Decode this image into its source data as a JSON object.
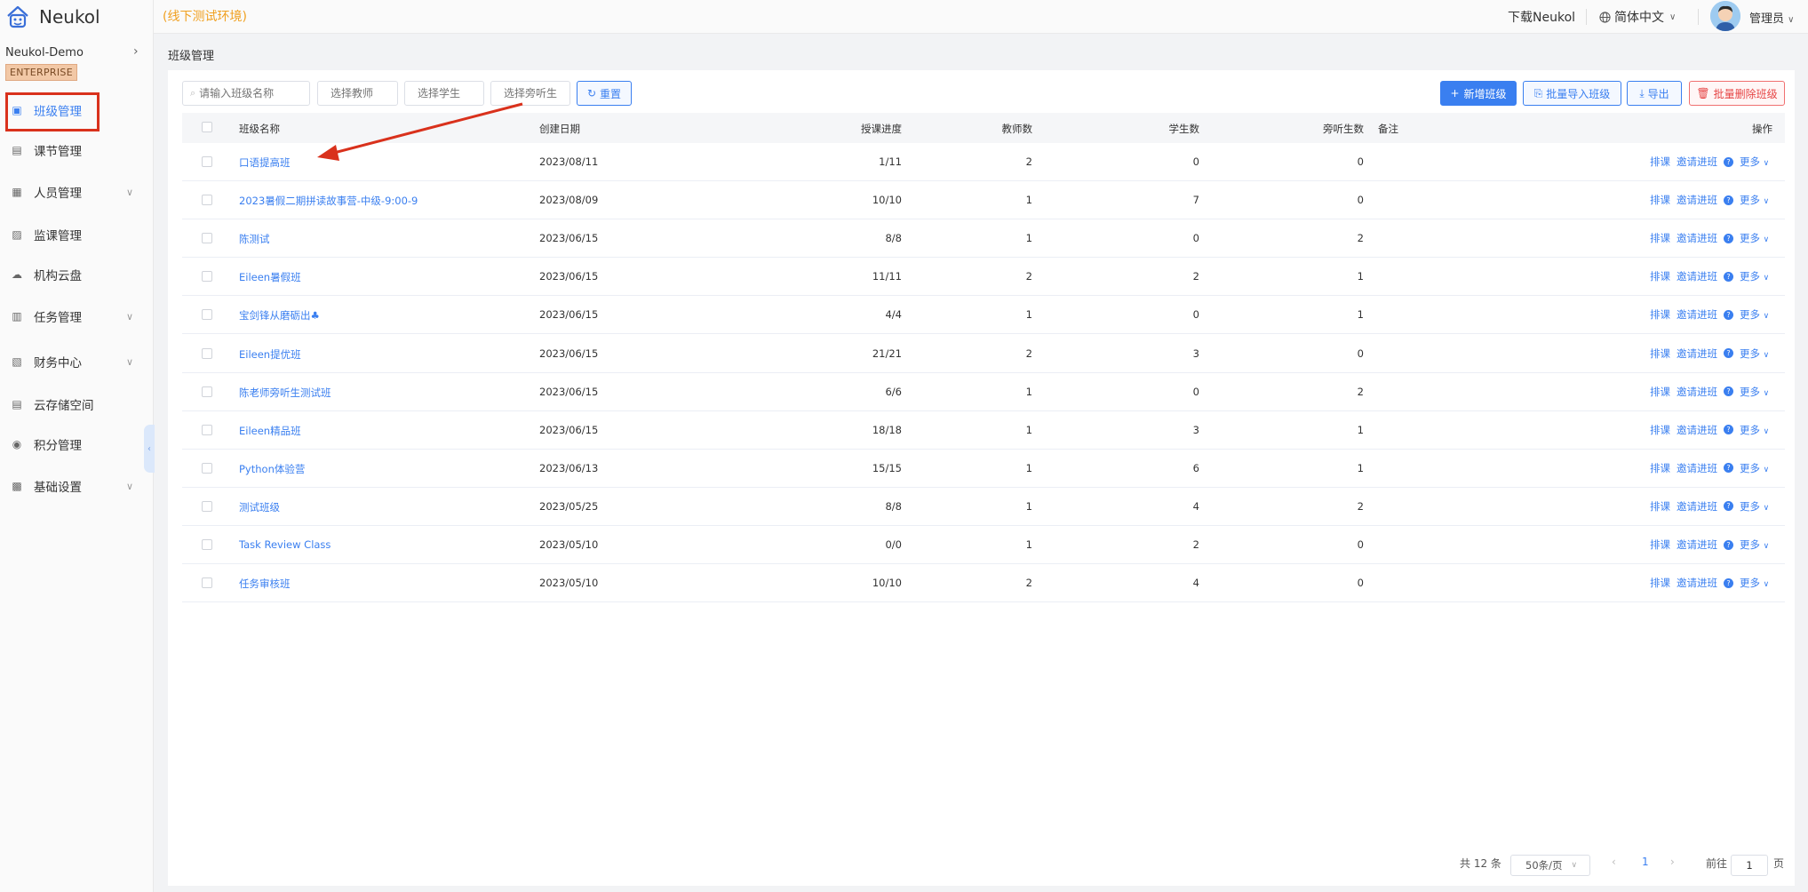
{
  "app": {
    "name": "Neukol",
    "env": "(线下测试环境)"
  },
  "sidebar": {
    "org": "Neukol-Demo",
    "badge": "ENTERPRISE",
    "items": [
      {
        "label": "班级管理",
        "icon": "class-icon",
        "active": true,
        "expandable": false
      },
      {
        "label": "课节管理",
        "icon": "lesson-icon",
        "expandable": false
      },
      {
        "label": "人员管理",
        "icon": "people-icon",
        "expandable": true
      },
      {
        "label": "监课管理",
        "icon": "monitor-icon",
        "expandable": false
      },
      {
        "label": "机构云盘",
        "icon": "cloud-icon",
        "expandable": false
      },
      {
        "label": "任务管理",
        "icon": "task-icon",
        "expandable": true
      },
      {
        "label": "财务中心",
        "icon": "finance-icon",
        "expandable": true
      },
      {
        "label": "云存储空间",
        "icon": "storage-icon",
        "expandable": false
      },
      {
        "label": "积分管理",
        "icon": "points-icon",
        "expandable": false
      },
      {
        "label": "基础设置",
        "icon": "settings-icon",
        "expandable": true
      }
    ]
  },
  "header": {
    "download": "下载Neukol",
    "language": "简体中文",
    "user": "管理员"
  },
  "breadcrumb": "班级管理",
  "filters": {
    "class_name_placeholder": "请输入班级名称",
    "teacher_placeholder": "选择教师",
    "student_placeholder": "选择学生",
    "auditor_placeholder": "选择旁听生",
    "reset": "重置"
  },
  "actions": {
    "add": "新增班级",
    "batch_import": "批量导入班级",
    "export": "导出",
    "batch_delete": "批量删除班级"
  },
  "table": {
    "headers": {
      "name": "班级名称",
      "date": "创建日期",
      "progress": "授课进度",
      "teachers": "教师数",
      "students": "学生数",
      "auditors": "旁听生数",
      "remark": "备注",
      "ops": "操作"
    },
    "row_actions": {
      "schedule": "排课",
      "invite": "邀请进班",
      "more": "更多"
    },
    "rows": [
      {
        "name": "口语提高班",
        "date": "2023/08/11",
        "progress": "1/11",
        "teachers": "2",
        "students": "0",
        "auditors": "0"
      },
      {
        "name": "2023暑假二期拼读故事营-中级-9:00-9",
        "date": "2023/08/09",
        "progress": "10/10",
        "teachers": "1",
        "students": "7",
        "auditors": "0"
      },
      {
        "name": "陈测试",
        "date": "2023/06/15",
        "progress": "8/8",
        "teachers": "1",
        "students": "0",
        "auditors": "2"
      },
      {
        "name": "Eileen暑假班",
        "date": "2023/06/15",
        "progress": "11/11",
        "teachers": "2",
        "students": "2",
        "auditors": "1"
      },
      {
        "name": "宝剑锋从磨砺出♣",
        "date": "2023/06/15",
        "progress": "4/4",
        "teachers": "1",
        "students": "0",
        "auditors": "1"
      },
      {
        "name": "Eileen提优班",
        "date": "2023/06/15",
        "progress": "21/21",
        "teachers": "2",
        "students": "3",
        "auditors": "0"
      },
      {
        "name": "陈老师旁听生测试班",
        "date": "2023/06/15",
        "progress": "6/6",
        "teachers": "1",
        "students": "0",
        "auditors": "2"
      },
      {
        "name": "Eileen精品班",
        "date": "2023/06/15",
        "progress": "18/18",
        "teachers": "1",
        "students": "3",
        "auditors": "1"
      },
      {
        "name": "Python体验营",
        "date": "2023/06/13",
        "progress": "15/15",
        "teachers": "1",
        "students": "6",
        "auditors": "1"
      },
      {
        "name": "测试班级",
        "date": "2023/05/25",
        "progress": "8/8",
        "teachers": "1",
        "students": "4",
        "auditors": "2"
      },
      {
        "name": "Task Review Class",
        "date": "2023/05/10",
        "progress": "0/0",
        "teachers": "1",
        "students": "2",
        "auditors": "0"
      },
      {
        "name": "任务审核班",
        "date": "2023/05/10",
        "progress": "10/10",
        "teachers": "2",
        "students": "4",
        "auditors": "0"
      }
    ]
  },
  "pagination": {
    "total": "共 12 条",
    "page_size": "50条/页",
    "current": "1",
    "goto_prefix": "前往",
    "goto_value": "1",
    "goto_suffix": "页"
  },
  "colors": {
    "accent": "#3a7ff0",
    "env": "#f0a020",
    "annotation": "#d9311c"
  }
}
